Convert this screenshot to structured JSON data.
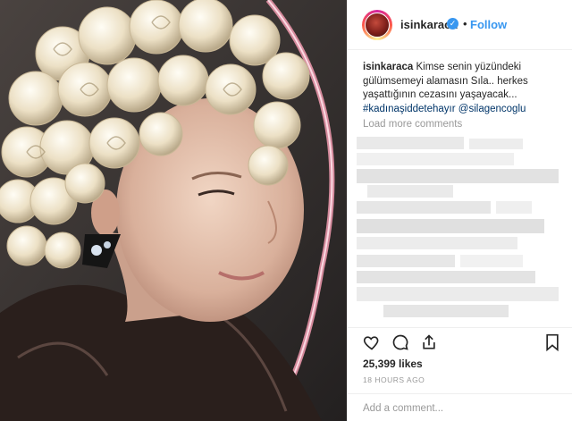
{
  "header": {
    "username": "isinkaraca",
    "verified_icon": "verified-badge-icon",
    "separator": "•",
    "follow_label": "Follow"
  },
  "caption": {
    "username": "isinkaraca",
    "text": "Kimse senin yüzündeki gülümsemeyi alamasın Sıla.. herkes yaşattığının cezasını yaşayacak...",
    "hashtag": "#kadınaşiddetehayır",
    "mention": "@silagencoglu"
  },
  "comments": {
    "load_more": "Load more comments",
    "state": "pixelated"
  },
  "actions": {
    "like_icon": "heart-icon",
    "comment_icon": "comment-icon",
    "share_icon": "share-icon",
    "save_icon": "bookmark-icon"
  },
  "likes": "25,399 likes",
  "timestamp": "18 HOURS AGO",
  "add_comment_placeholder": "Add a comment...",
  "colors": {
    "link": "#3897f0",
    "hashtag": "#003569",
    "muted": "#999999",
    "text": "#262626"
  }
}
